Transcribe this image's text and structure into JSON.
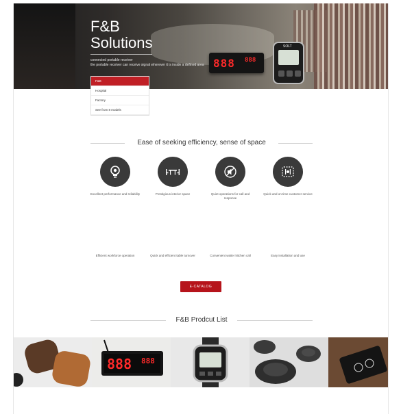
{
  "hero": {
    "title_line1": "F&B",
    "title_line2": "Solutions",
    "subtitle_line1": "connected portable receiver",
    "subtitle_line2": "the portable receiver can receive signal wherever it is inside a defined area",
    "pager_digits": "888",
    "pager_digits_small": "888",
    "watch_brand": "SOLT"
  },
  "dropdown": {
    "options": [
      "F&B",
      "Hospital",
      "Factory",
      "See from 8 models"
    ],
    "active_index": 0
  },
  "section1": {
    "heading": "Ease of seeking efficiency, sense of space",
    "features_row1": [
      {
        "icon": "lightbulb-icon",
        "label": "Excellent performance and reliability"
      },
      {
        "icon": "dining-table-icon",
        "label": "Prestigious interior space"
      },
      {
        "icon": "mute-icon",
        "label": "Quiet operations for call and response"
      },
      {
        "icon": "restaurant-service-icon",
        "label": "Quick and on time customer service"
      }
    ],
    "features_row2": [
      {
        "label": "Efficient workforce operation"
      },
      {
        "label": "Quick and efficient table turnover"
      },
      {
        "label": "Convenient waiter kitchen call"
      },
      {
        "label": "Easy installation and use"
      }
    ]
  },
  "ecatalog_label": "E-CATALOG",
  "section2": {
    "heading": "F&B Prodcut List"
  },
  "products": [
    {
      "name": "wooden-buttons"
    },
    {
      "name": "led-display"
    },
    {
      "name": "watch-receiver"
    },
    {
      "name": "call-buttons"
    },
    {
      "name": "table-pad"
    }
  ],
  "colors": {
    "accent": "#b6141b",
    "icon_circle": "#3a3a3a",
    "led_red": "#ff2a2a"
  }
}
